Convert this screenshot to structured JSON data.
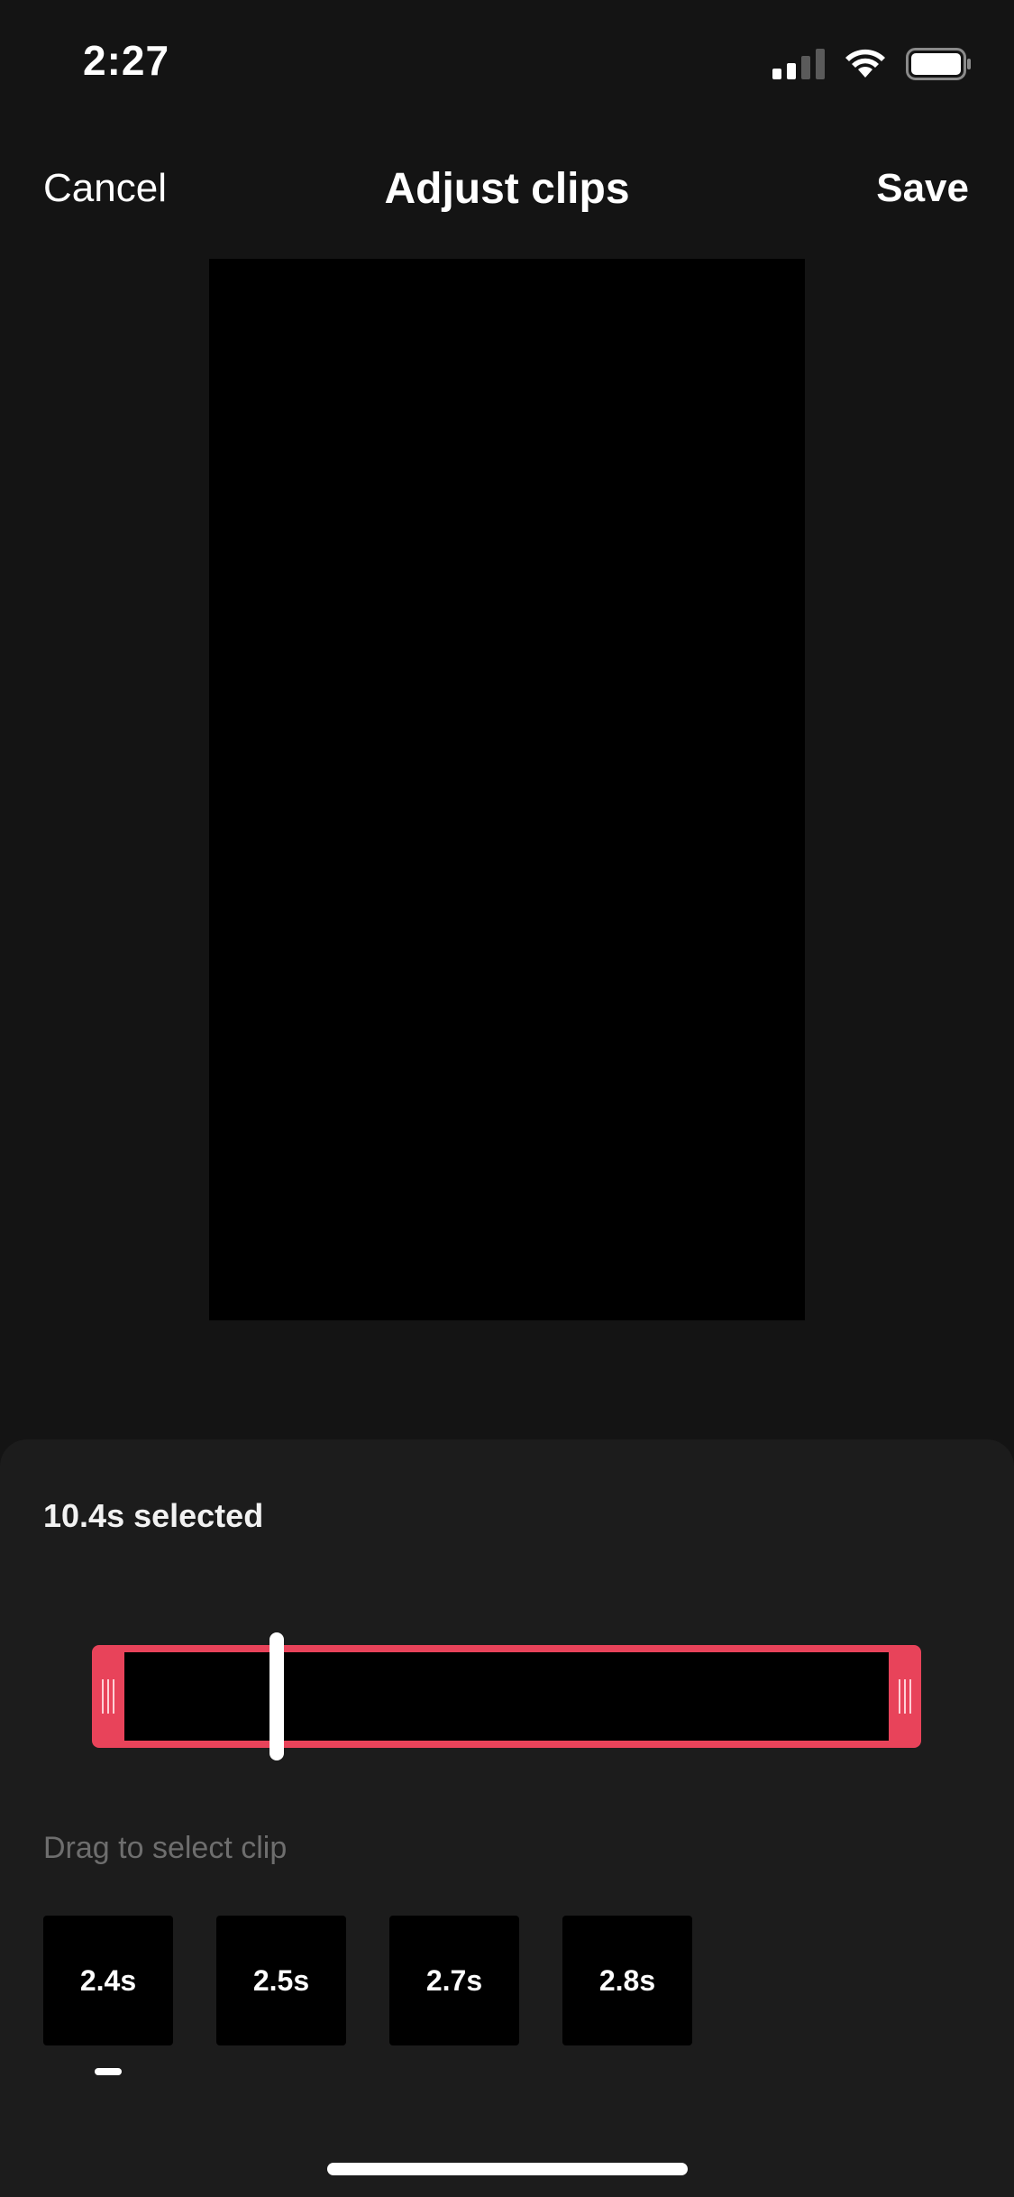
{
  "status_bar": {
    "time": "2:27",
    "icons": [
      "cellular-signal-icon",
      "wifi-icon",
      "battery-icon"
    ]
  },
  "nav": {
    "cancel_label": "Cancel",
    "title": "Adjust clips",
    "save_label": "Save"
  },
  "editor": {
    "selected_text": "10.4s selected",
    "hint": "Drag to select clip",
    "clips": [
      {
        "duration": "2.4s"
      },
      {
        "duration": "2.5s"
      },
      {
        "duration": "2.7s"
      },
      {
        "duration": "2.8s"
      }
    ],
    "active_clip_index": 0
  },
  "colors": {
    "background": "#141414",
    "sheet": "#1c1c1c",
    "accent": "#e8435a",
    "hint_text": "#6e6e6e"
  }
}
